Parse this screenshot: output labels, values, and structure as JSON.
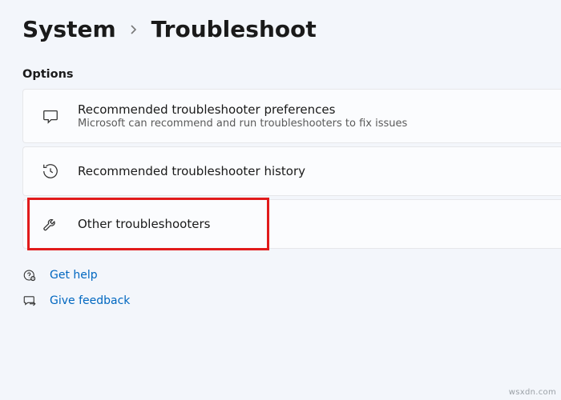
{
  "breadcrumb": {
    "parent": "System",
    "current": "Troubleshoot"
  },
  "section_label": "Options",
  "options": [
    {
      "title": "Recommended troubleshooter preferences",
      "subtitle": "Microsoft can recommend and run troubleshooters to fix issues"
    },
    {
      "title": "Recommended troubleshooter history",
      "subtitle": ""
    },
    {
      "title": "Other troubleshooters",
      "subtitle": ""
    }
  ],
  "links": {
    "help": "Get help",
    "feedback": "Give feedback"
  },
  "watermark": "wsxdn.com"
}
